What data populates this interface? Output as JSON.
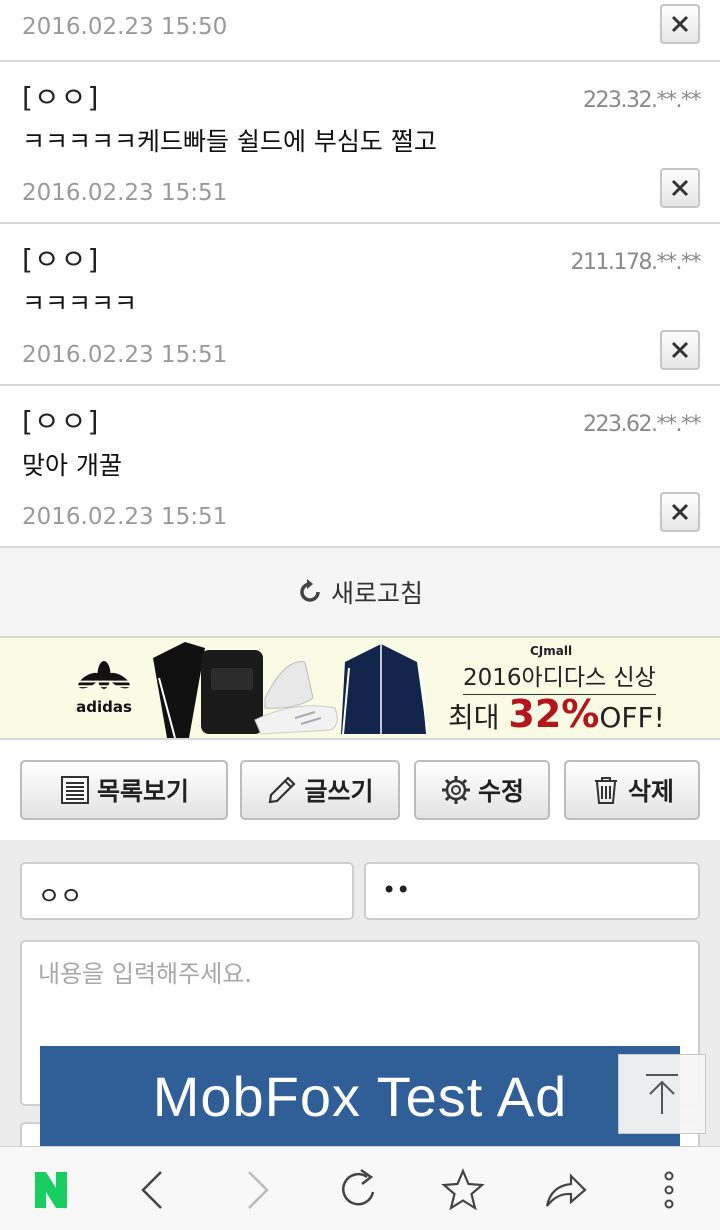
{
  "comments": [
    {
      "author": "",
      "ip": "",
      "body": "",
      "date": "2016.02.23 15:50"
    },
    {
      "author": "[ㅇㅇ]",
      "ip": "223.32.**.**",
      "body": "ㅋㅋㅋㅋㅋ케드빠들 쉴드에 부심도 쩔고",
      "date": "2016.02.23 15:51"
    },
    {
      "author": "[ㅇㅇ]",
      "ip": "211.178.**.**",
      "body": "ㅋㅋㅋㅋㅋ",
      "date": "2016.02.23 15:51"
    },
    {
      "author": "[ㅇㅇ]",
      "ip": "223.62.**.**",
      "body": "맞아 개꿀",
      "date": "2016.02.23 15:51"
    }
  ],
  "refresh_label": "새로고침",
  "banner": {
    "brand": "adidas",
    "seller": "CJmall",
    "headline": "2016아디다스 신상",
    "promo_prefix": "최대 ",
    "promo_pct": "32%",
    "promo_suffix": "OFF!"
  },
  "actions": {
    "list": "목록보기",
    "write": "글쓰기",
    "edit": "수정",
    "delete": "삭제"
  },
  "form": {
    "name_value": "ㅇㅇ",
    "password_value": "••",
    "content_placeholder": "내용을 입력해주세요."
  },
  "ad_text": "MobFox Test Ad",
  "colors": {
    "naver_green": "#19ce60",
    "promo_red": "#b3151b",
    "ad_blue": "#2f5f96"
  }
}
